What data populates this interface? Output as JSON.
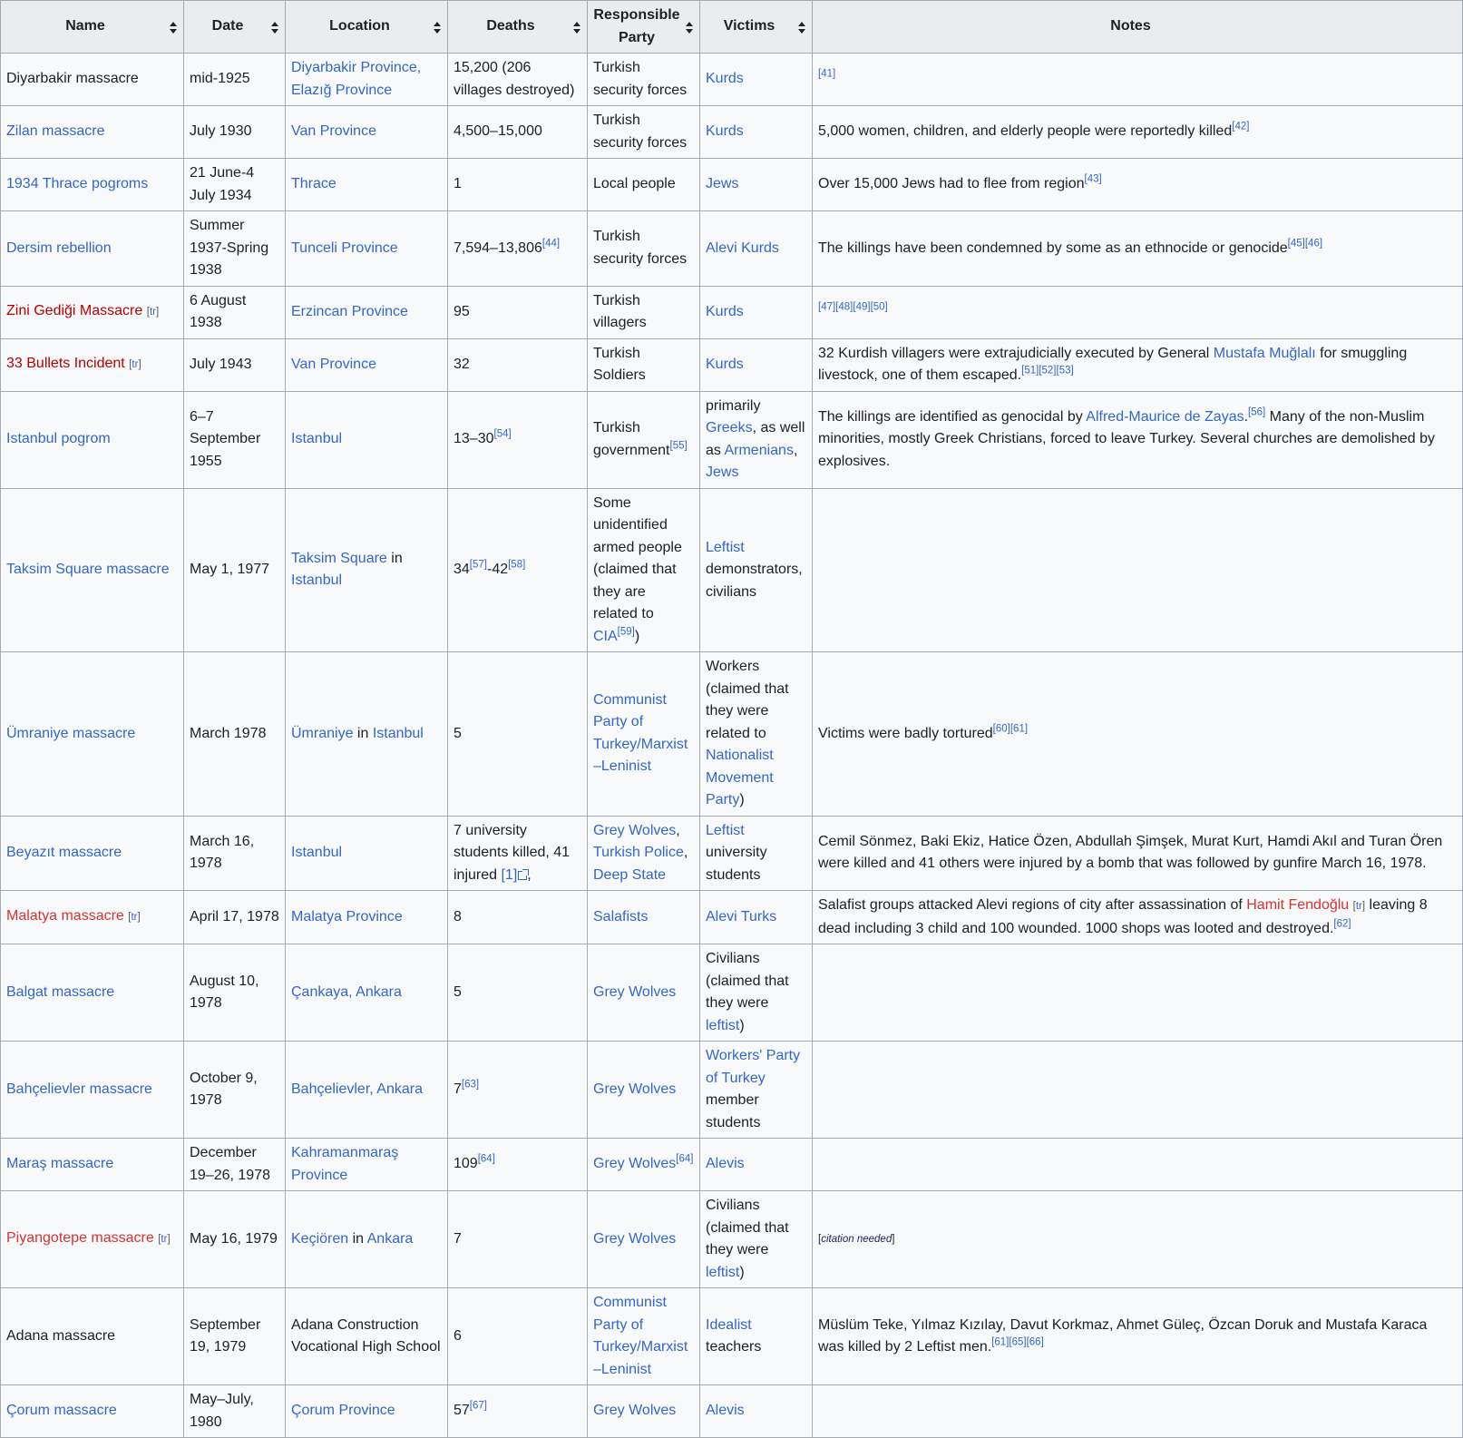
{
  "headers": {
    "name": "Name",
    "date": "Date",
    "location": "Location",
    "deaths": "Deaths",
    "party": "Responsible Party",
    "victims": "Victims",
    "notes": "Notes"
  },
  "colors": {
    "link": "#3366cc",
    "redlink": "#d73333",
    "header_bg": "#eaecf0",
    "cell_bg": "#f8f9fa",
    "border": "#a2a9b1"
  },
  "rows": [
    {
      "name": "Diyarbakir massacre",
      "date": "mid-1925",
      "location_a": "Diyarbakir Province,",
      "location_b": "Elazığ Province",
      "deaths": "15,200 (206 villages destroyed)",
      "party": "Turkish security forces",
      "victims": "Kurds",
      "notes_ref": "[41]"
    },
    {
      "name": "Zilan massacre",
      "date": "July 1930",
      "location": "Van Province",
      "deaths": "4,500–15,000",
      "party": "Turkish security forces",
      "victims": "Kurds",
      "notes": "5,000 women, children, and elderly people were reportedly killed",
      "notes_ref": "[42]"
    },
    {
      "name": "1934 Thrace pogroms",
      "date": "21 June-4 July 1934",
      "location": "Thrace",
      "deaths": "1",
      "party": "Local people",
      "victims": "Jews",
      "notes": "Over 15,000 Jews had to flee from region",
      "notes_ref": "[43]"
    },
    {
      "name": "Dersim rebellion",
      "date": "Summer 1937-Spring 1938",
      "location": "Tunceli Province",
      "deaths": "7,594–13,806",
      "deaths_ref": "[44]",
      "party": "Turkish security forces",
      "victims": "Alevi Kurds",
      "notes": "The killings have been condemned by some as an ethnocide or genocide",
      "notes_ref_a": "[45]",
      "notes_ref_b": "[46]"
    },
    {
      "name": "Zini Gediği Massacre",
      "name_ilh": "tr",
      "date": "6 August 1938",
      "location": "Erzincan Province",
      "deaths": "95",
      "party": "Turkish villagers",
      "victims": "Kurds",
      "notes_refs": [
        "[47]",
        "[48]",
        "[49]",
        "[50]"
      ]
    },
    {
      "name": "33 Bullets Incident",
      "name_ilh": "tr",
      "date": "July 1943",
      "location": "Van Province",
      "deaths": "32",
      "party": "Turkish Soldiers",
      "victims": "Kurds",
      "notes_a": "32 Kurdish villagers were extrajudicially executed by General ",
      "notes_link": "Mustafa Muğlalı",
      "notes_b": " for smuggling livestock, one of them escaped.",
      "notes_refs": [
        "[51]",
        "[52]",
        "[53]"
      ]
    },
    {
      "name": "Istanbul pogrom",
      "date": "6–7 September 1955",
      "location": "Istanbul",
      "deaths": "13–30",
      "deaths_ref": "[54]",
      "party": "Turkish government",
      "party_ref": "[55]",
      "victims_a": "primarily ",
      "victims_l1": "Greeks",
      "victims_b": ", as well as ",
      "victims_l2": "Armenians",
      "victims_c": ", ",
      "victims_l3": "Jews",
      "notes_a": "The killings are identified as genocidal by ",
      "notes_link": "Alfred-Maurice de Zayas",
      "notes_b": ".",
      "notes_ref": "[56]",
      "notes_c": " Many of the non-Muslim minorities, mostly Greek Christians, forced to leave Turkey. Several churches are demolished by explosives."
    },
    {
      "name": "Taksim Square massacre",
      "date": "May 1, 1977",
      "location_link": "Taksim Square",
      "location_mid": " in ",
      "location_link2": "Istanbul",
      "deaths_a": "34",
      "deaths_ref_a": "[57]",
      "deaths_b": "-42",
      "deaths_ref_b": "[58]",
      "party_a": "Some unidentified armed people (claimed that they are related to ",
      "party_link": "CIA",
      "party_ref": "[59]",
      "party_b": ")",
      "victims_link": "Leftist",
      "victims_b": " demonstrators, civilians"
    },
    {
      "name": "Ümraniye massacre",
      "date": "March 1978",
      "location_link": "Ümraniye",
      "location_mid": " in ",
      "location_link2": "Istanbul",
      "deaths": "5",
      "party": "Communist Party of Turkey/Marxist–Leninist",
      "victims_a": "Workers (claimed that they were related to ",
      "victims_link": "Nationalist Movement Party",
      "victims_b": ")",
      "notes": "Victims were badly tortured",
      "notes_ref_a": "[60]",
      "notes_ref_b": "[61]"
    },
    {
      "name": "Beyazıt massacre",
      "date": "March 16, 1978",
      "location": "Istanbul",
      "deaths": "7 university students killed, 41 injured ",
      "deaths_ext": "[1]",
      "deaths_tail": ",",
      "party_l1": "Grey Wolves",
      "party_l2": "Turkish Police",
      "party_l3": "Deep State",
      "victims_link": "Leftist",
      "victims_b": " university students",
      "notes": "Cemil Sönmez, Baki Ekiz, Hatice Özen, Abdullah Şimşek, Murat Kurt, Hamdi Akıl and Turan Ören were killed and 41 others were injured by a bomb that was followed by gunfire March 16, 1978."
    },
    {
      "name": "Malatya massacre",
      "name_ilh": "tr",
      "date": "April 17, 1978",
      "location": "Malatya Province",
      "deaths": "8",
      "party": "Salafists",
      "victims": "Alevi Turks",
      "notes_a": "Salafist groups attacked Alevi regions of city after assassination of ",
      "notes_link": "Hamit Fendoğlu",
      "notes_ilh": "tr",
      "notes_b": " leaving 8 dead including 3 child and 100 wounded. 1000 shops was looted and destroyed.",
      "notes_ref": "[62]"
    },
    {
      "name": "Balgat massacre",
      "date": "August 10, 1978",
      "location": "Çankaya, Ankara",
      "deaths": "5",
      "party": "Grey Wolves",
      "victims_a": "Civilians (claimed that they were ",
      "victims_link": "leftist",
      "victims_b": ")"
    },
    {
      "name": "Bahçelievler massacre",
      "date": "October 9, 1978",
      "location": "Bahçelievler, Ankara",
      "deaths": "7",
      "deaths_ref": "[63]",
      "party": "Grey Wolves",
      "victims_link": "Workers' Party of Turkey",
      "victims_b": " member students"
    },
    {
      "name": "Maraş massacre",
      "date": "December 19–26, 1978",
      "location": "Kahramanmaraş Province",
      "deaths": "109",
      "deaths_ref": "[64]",
      "party": "Grey Wolves",
      "party_ref": "[64]",
      "victims": "Alevis"
    },
    {
      "name": "Piyangotepe massacre",
      "name_ilh": "tr",
      "date": "May 16, 1979",
      "location_link": "Keçiören",
      "location_mid": " in ",
      "location_link2": "Ankara",
      "deaths": "7",
      "party": "Grey Wolves",
      "victims_a": "Civilians (claimed that they were ",
      "victims_link": "leftist",
      "victims_b": ")",
      "notes_cn": "citation needed"
    },
    {
      "name": "Adana massacre",
      "date": "September 19, 1979",
      "location": "Adana Construction Vocational High School",
      "deaths": "6",
      "party": "Communist Party of Turkey/Marxist–Leninist",
      "victims_link": "Idealist",
      "victims_b": " teachers",
      "notes": "Müslüm Teke, Yılmaz Kızılay, Davut Korkmaz, Ahmet Güleç, Özcan Doruk and Mustafa Karaca was killed by 2 Leftist men.",
      "notes_refs": [
        "[61]",
        "[65]",
        "[66]"
      ]
    },
    {
      "name": "Çorum massacre",
      "date": "May–July, 1980",
      "location": "Çorum Province",
      "deaths": "57",
      "deaths_ref": "[67]",
      "party": "Grey Wolves",
      "victims": "Alevis"
    }
  ]
}
